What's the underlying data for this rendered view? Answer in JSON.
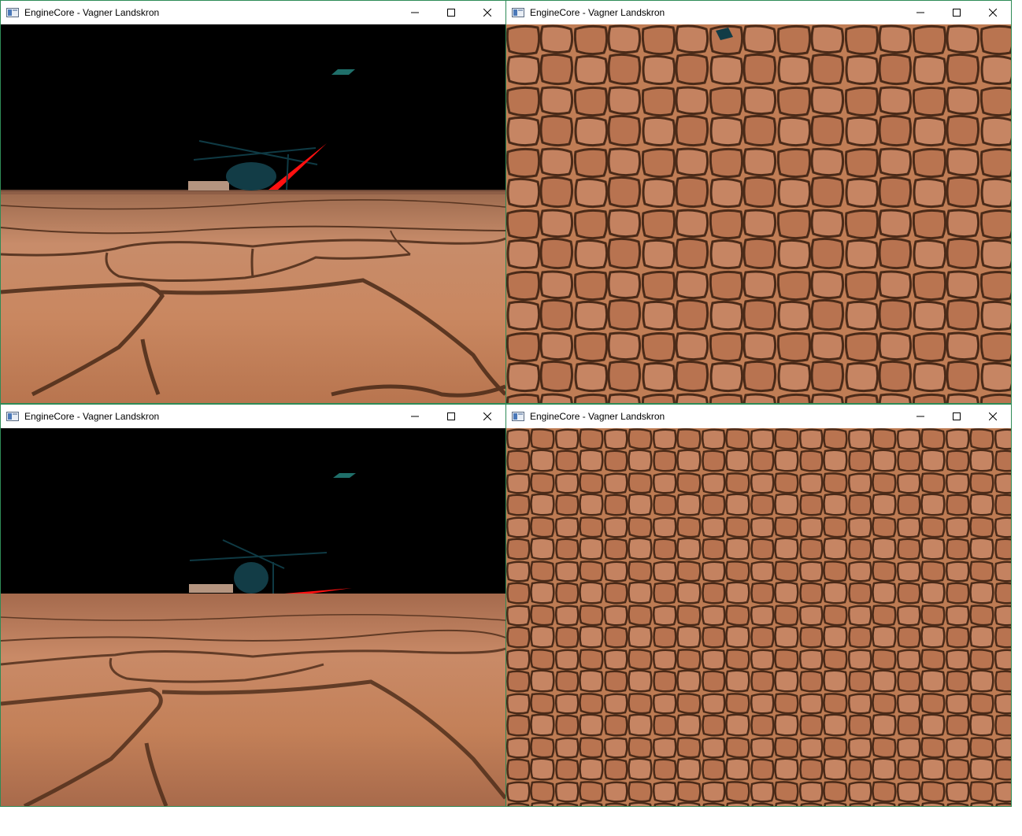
{
  "windows": [
    {
      "id": "top-left",
      "title": "EngineCore - Vagner Landskron",
      "view": "perspective"
    },
    {
      "id": "top-right",
      "title": "EngineCore - Vagner Landskron",
      "view": "top-down"
    },
    {
      "id": "bottom-left",
      "title": "EngineCore - Vagner Landskron",
      "view": "perspective"
    },
    {
      "id": "bottom-right",
      "title": "EngineCore - Vagner Landskron",
      "view": "top-down"
    }
  ],
  "controls": {
    "minimize": "minimize-icon",
    "maximize": "maximize-icon",
    "close": "close-icon"
  },
  "colors": {
    "sky": "#000000",
    "terrain": "#c27f5c",
    "crack": "#4a2a18",
    "helicopter": "#0f3a44",
    "tail_fin": "#ff1010",
    "marker": "#1f6f6a",
    "window_border": "#2e8b57"
  }
}
